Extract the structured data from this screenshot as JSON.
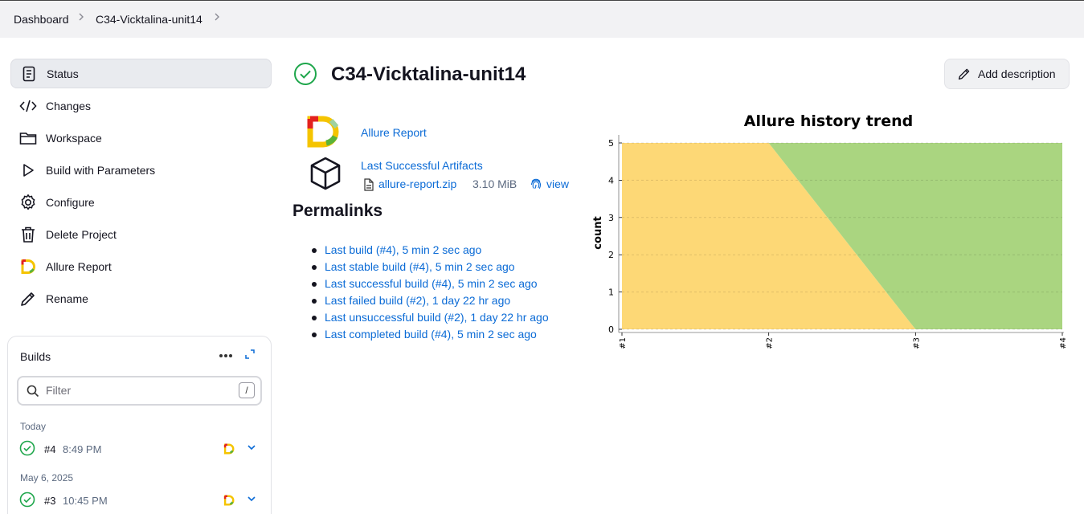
{
  "breadcrumb": {
    "items": [
      "Dashboard",
      "C34-Vicktalina-unit14"
    ]
  },
  "sidebar": {
    "items": [
      {
        "label": "Status",
        "icon": "status-icon"
      },
      {
        "label": "Changes",
        "icon": "code-icon"
      },
      {
        "label": "Workspace",
        "icon": "folder-icon"
      },
      {
        "label": "Build with Parameters",
        "icon": "play-icon"
      },
      {
        "label": "Configure",
        "icon": "gear-icon"
      },
      {
        "label": "Delete Project",
        "icon": "trash-icon"
      },
      {
        "label": "Allure Report",
        "icon": "allure-logo-icon"
      },
      {
        "label": "Rename",
        "icon": "pencil-icon"
      }
    ]
  },
  "builds": {
    "title": "Builds",
    "filter_placeholder": "Filter",
    "filter_shortcut": "/",
    "groups": [
      {
        "label": "Today",
        "builds": [
          {
            "number": "#4",
            "time": "8:49 PM",
            "status": "success"
          }
        ]
      },
      {
        "label": "May 6, 2025",
        "builds": [
          {
            "number": "#3",
            "time": "10:45 PM",
            "status": "success"
          }
        ]
      }
    ]
  },
  "main": {
    "title": "C34-Vicktalina-unit14",
    "add_description": "Add description",
    "allure_link": "Allure Report",
    "artifacts_link": "Last Successful Artifacts",
    "artifact": {
      "name": "allure-report.zip",
      "size": "3.10 MiB",
      "view": "view"
    },
    "permalinks_title": "Permalinks",
    "permalinks": [
      "Last build (#4), 5 min 2 sec ago",
      "Last stable build (#4), 5 min 2 sec ago",
      "Last successful build (#4), 5 min 2 sec ago",
      "Last failed build (#2), 1 day 22 hr ago",
      "Last unsuccessful build (#2), 1 day 22 hr ago",
      "Last completed build (#4), 5 min 2 sec ago"
    ]
  },
  "colors": {
    "accent": "#0b6bd6",
    "success": "#1ea64b",
    "broken": "#fdd876",
    "passed": "#aad580"
  },
  "chart_data": {
    "type": "area",
    "title": "Allure history trend",
    "ylabel": "count",
    "xlabel": "",
    "categories": [
      "#1",
      "#2",
      "#3",
      "#4"
    ],
    "ylim": [
      0,
      5
    ],
    "yticks": [
      "0",
      "1",
      "2",
      "3",
      "4",
      "5"
    ],
    "stacked": true,
    "series": [
      {
        "values": [
          5,
          5,
          0,
          0
        ],
        "color": "#fdd876"
      },
      {
        "values": [
          0,
          0,
          5,
          5
        ],
        "color": "#aad580"
      }
    ],
    "grid": true
  }
}
